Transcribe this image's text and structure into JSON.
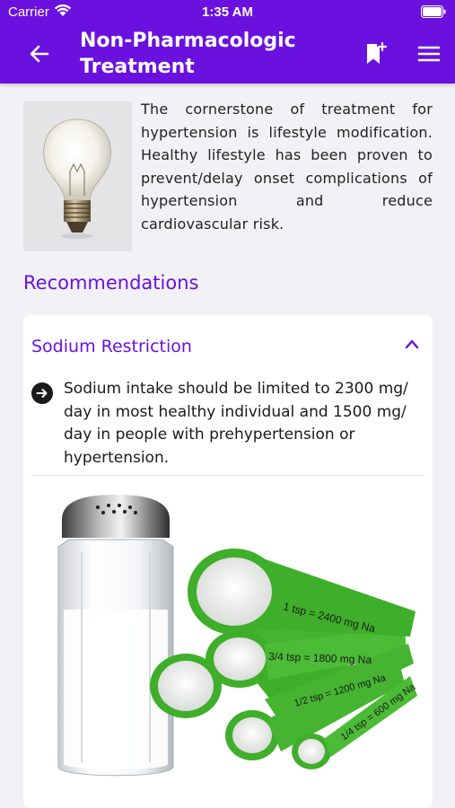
{
  "status_bar": {
    "carrier": "Carrier",
    "time": "1:35 AM"
  },
  "nav": {
    "title": "Non-Pharmacologic Treatment",
    "icons": [
      "back-arrow-icon",
      "bookmark-add-icon",
      "hamburger-menu-icon"
    ]
  },
  "intro": {
    "image": "light-bulb",
    "text": "The cornerstone of treatment for hypertension is lifestyle modification. Healthy lifestyle has been proven to prevent/delay onset complications of hypertension and reduce cardiovascular risk."
  },
  "recommendations": {
    "heading": "Recommendations",
    "card": {
      "title": "Sodium Restriction",
      "expanded": true,
      "bullet": "Sodium intake should be limited to 2300 mg/ day in most healthy individual and  1500 mg/ day in people with prehypertension or hypertension.",
      "image_labels": {
        "spoon1": "1 tsp = 2400 mg Na",
        "spoon2": "3/4 tsp = 1800 mg Na",
        "spoon3": "1/2 tsp = 1200 mg Na",
        "spoon4": "1/4 tsp = 600 mg Na"
      }
    }
  },
  "colors": {
    "primary": "#6a11e0",
    "background": "#f2f2f6",
    "card": "#ffffff",
    "text": "#1a1a1a",
    "spoon_green": "#3fae2a"
  }
}
